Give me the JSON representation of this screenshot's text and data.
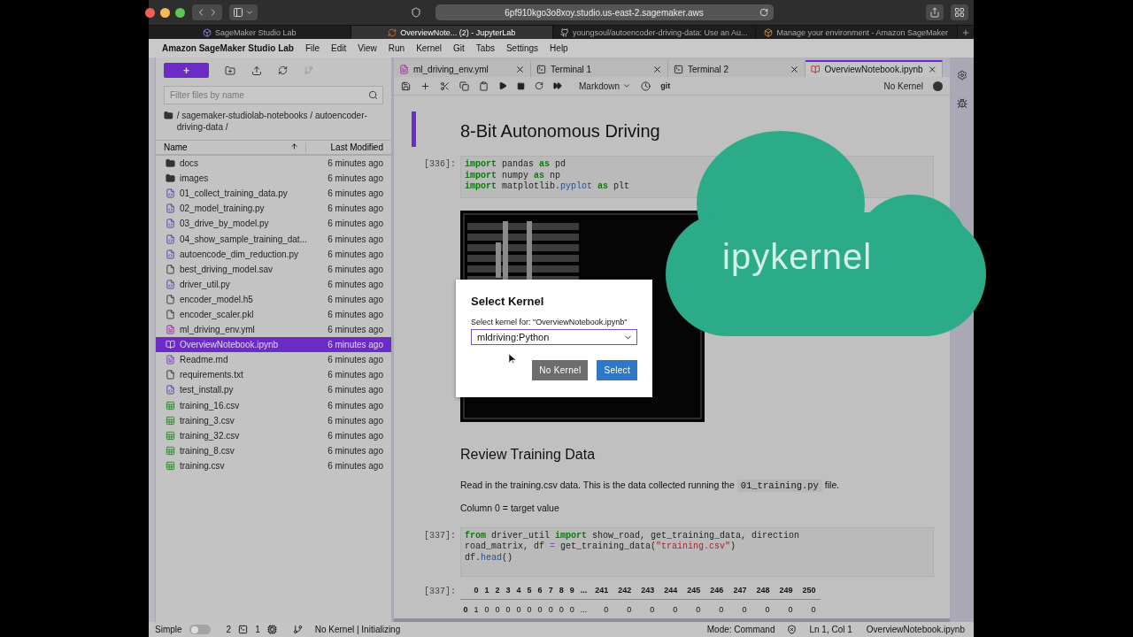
{
  "browser": {
    "address": "6pf910kgo3o8xoy.studio.us-east-2.sagemaker.aws",
    "tabs": [
      {
        "title": "SageMaker Studio Lab",
        "kind": "studio",
        "selected": false
      },
      {
        "title": "OverviewNote... (2) - JupyterLab",
        "kind": "jupyter",
        "selected": true
      },
      {
        "title": "youngsoul/autoencoder-driving-data: Use an Au...",
        "kind": "github",
        "selected": false
      },
      {
        "title": "Manage your environment - Amazon SageMaker",
        "kind": "aws",
        "selected": false
      }
    ]
  },
  "menu": {
    "app_title": "Amazon SageMaker Studio Lab",
    "items": [
      "File",
      "Edit",
      "View",
      "Run",
      "Kernel",
      "Git",
      "Tabs",
      "Settings",
      "Help"
    ]
  },
  "sidebar": {
    "new_button": "+",
    "filter_placeholder": "Filter files by name",
    "breadcrumb": "/ sagemaker-studiolab-notebooks / autoencoder-driving-data /",
    "columns": [
      "Name",
      "Last Modified"
    ],
    "files": [
      {
        "name": "docs",
        "kind": "folder",
        "modified": "6 minutes ago",
        "selected": false
      },
      {
        "name": "images",
        "kind": "folder",
        "modified": "6 minutes ago",
        "selected": false
      },
      {
        "name": "01_collect_training_data.py",
        "kind": "python",
        "modified": "6 minutes ago",
        "selected": false
      },
      {
        "name": "02_model_training.py",
        "kind": "python",
        "modified": "6 minutes ago",
        "selected": false
      },
      {
        "name": "03_drive_by_model.py",
        "kind": "python",
        "modified": "6 minutes ago",
        "selected": false
      },
      {
        "name": "04_show_sample_training_dat...",
        "kind": "python",
        "modified": "6 minutes ago",
        "selected": false
      },
      {
        "name": "autoencode_dim_reduction.py",
        "kind": "python",
        "modified": "6 minutes ago",
        "selected": false
      },
      {
        "name": "best_driving_model.sav",
        "kind": "file",
        "modified": "6 minutes ago",
        "selected": false
      },
      {
        "name": "driver_util.py",
        "kind": "python",
        "modified": "6 minutes ago",
        "selected": false
      },
      {
        "name": "encoder_model.h5",
        "kind": "file",
        "modified": "6 minutes ago",
        "selected": false
      },
      {
        "name": "encoder_scaler.pkl",
        "kind": "file",
        "modified": "6 minutes ago",
        "selected": false
      },
      {
        "name": "ml_driving_env.yml",
        "kind": "yaml",
        "modified": "6 minutes ago",
        "selected": false
      },
      {
        "name": "OverviewNotebook.ipynb",
        "kind": "notebook",
        "modified": "6 minutes ago",
        "selected": true
      },
      {
        "name": "Readme.md",
        "kind": "markdown",
        "modified": "6 minutes ago",
        "selected": false
      },
      {
        "name": "requirements.txt",
        "kind": "file",
        "modified": "6 minutes ago",
        "selected": false
      },
      {
        "name": "test_install.py",
        "kind": "python",
        "modified": "6 minutes ago",
        "selected": false
      },
      {
        "name": "training_16.csv",
        "kind": "csv",
        "modified": "6 minutes ago",
        "selected": false
      },
      {
        "name": "training_3.csv",
        "kind": "csv",
        "modified": "6 minutes ago",
        "selected": false
      },
      {
        "name": "training_32.csv",
        "kind": "csv",
        "modified": "6 minutes ago",
        "selected": false
      },
      {
        "name": "training_8.csv",
        "kind": "csv",
        "modified": "6 minutes ago",
        "selected": false
      },
      {
        "name": "training.csv",
        "kind": "csv",
        "modified": "6 minutes ago",
        "selected": false
      }
    ]
  },
  "editor_tabs": [
    {
      "label": "ml_driving_env.yml",
      "kind": "yaml",
      "selected": false
    },
    {
      "label": "Terminal 1",
      "kind": "terminal",
      "selected": false
    },
    {
      "label": "Terminal 2",
      "kind": "terminal",
      "selected": false
    },
    {
      "label": "OverviewNotebook.ipynb",
      "kind": "notebook",
      "selected": true
    }
  ],
  "toolbar": {
    "cell_type": "Markdown",
    "git": "git",
    "kernel": "No Kernel"
  },
  "cells": [
    {
      "kind": "heading",
      "text": "8-Bit Autonomous Driving",
      "active": true
    },
    {
      "kind": "code",
      "prompt": "[336]:",
      "lines": [
        [
          {
            "t": "import",
            "kind": "keyword"
          },
          {
            "t": " pandas ",
            "kind": "plain"
          },
          {
            "t": "as",
            "kind": "keyword"
          },
          {
            "t": " pd",
            "kind": "plain"
          }
        ],
        [
          {
            "t": "import",
            "kind": "keyword"
          },
          {
            "t": " numpy ",
            "kind": "plain"
          },
          {
            "t": "as",
            "kind": "keyword"
          },
          {
            "t": " np",
            "kind": "plain"
          }
        ],
        [
          {
            "t": "import",
            "kind": "keyword"
          },
          {
            "t": " matplotlib.",
            "kind": "plain"
          },
          {
            "t": "pyplot",
            "kind": "function"
          },
          {
            "t": " as",
            "kind": "keyword"
          },
          {
            "t": " plt",
            "kind": "plain"
          }
        ]
      ]
    },
    {
      "kind": "picture"
    },
    {
      "kind": "heading",
      "text": "Review Training Data",
      "active": false
    },
    {
      "kind": "paragraph",
      "parts": [
        {
          "t": "Read in the training.csv data. This is the data collected running the ",
          "kind": "text"
        },
        {
          "t": "01_training.py",
          "kind": "code"
        },
        {
          "t": " file.",
          "kind": "text"
        }
      ]
    },
    {
      "kind": "paragraph",
      "parts": [
        {
          "t": "Column 0 = target value",
          "kind": "text"
        }
      ]
    },
    {
      "kind": "code",
      "prompt": "[337]:",
      "lines": [
        [
          {
            "t": "from",
            "kind": "keyword"
          },
          {
            "t": " driver_util ",
            "kind": "plain"
          },
          {
            "t": "import",
            "kind": "keyword"
          },
          {
            "t": " show_road, get_training_data, direction",
            "kind": "plain"
          }
        ],
        [
          {
            "t": "road_matrix, df ",
            "kind": "plain"
          },
          {
            "t": "=",
            "kind": "operator"
          },
          {
            "t": " get_training_data(",
            "kind": "plain"
          },
          {
            "t": "\"training.csv\"",
            "kind": "string"
          },
          {
            "t": ")",
            "kind": "plain"
          }
        ],
        [
          {
            "t": "df.",
            "kind": "plain"
          },
          {
            "t": "head",
            "kind": "function"
          },
          {
            "t": "()",
            "kind": "plain"
          }
        ]
      ]
    },
    {
      "kind": "table",
      "prompt": "[337]:",
      "header": [
        "0",
        "1",
        "2",
        "3",
        "4",
        "5",
        "6",
        "7",
        "8",
        "9",
        "...",
        "241",
        "242",
        "243",
        "244",
        "245",
        "246",
        "247",
        "248",
        "249",
        "250"
      ],
      "rows": [
        {
          "index": "0",
          "values": [
            "1",
            "0",
            "0",
            "0",
            "0",
            "0",
            "0",
            "0",
            "0",
            "0",
            "...",
            "0",
            "0",
            "0",
            "0",
            "0",
            "0",
            "0",
            "0",
            "0",
            "0"
          ]
        }
      ]
    }
  ],
  "dialog": {
    "title": "Select Kernel",
    "label": "Select kernel for: \"OverviewNotebook.ipynb\"",
    "value": "mldriving:Python",
    "buttons": [
      {
        "label": "No Kernel",
        "kind": "secondary"
      },
      {
        "label": "Select",
        "kind": "primary"
      }
    ]
  },
  "overlay": {
    "text": "ipykernel"
  },
  "status": {
    "simple_label": "Simple",
    "simple_on": false,
    "terminals": "2",
    "kernels": "1",
    "kernel_status": "No Kernel | Initializing",
    "mode": "Mode: Command",
    "position": "Ln 1, Col 1",
    "file": "OverviewNotebook.ipynb"
  }
}
